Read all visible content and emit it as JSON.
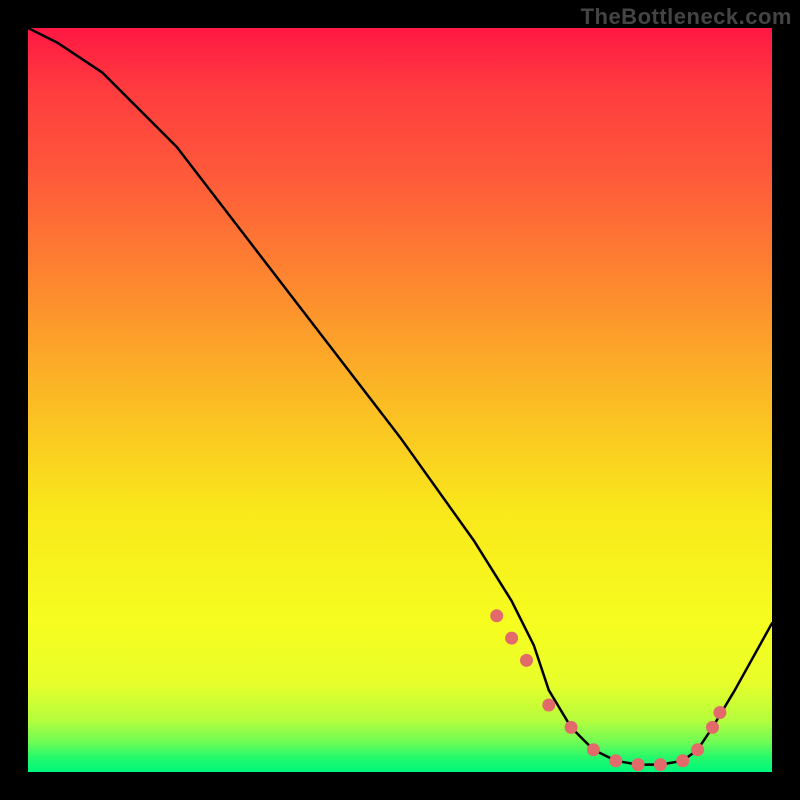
{
  "watermark": "TheBottleneck.com",
  "chart_data": {
    "type": "line",
    "title": "",
    "xlabel": "",
    "ylabel": "",
    "xlim": [
      0,
      100
    ],
    "ylim": [
      0,
      100
    ],
    "series": [
      {
        "name": "curve",
        "x": [
          0,
          4,
          10,
          20,
          30,
          40,
          50,
          60,
          65,
          68,
          70,
          73,
          76,
          79,
          82,
          85,
          88,
          90,
          92,
          95,
          100
        ],
        "values": [
          100,
          98,
          94,
          84,
          71,
          58,
          45,
          31,
          23,
          17,
          11,
          6,
          3,
          1.5,
          1,
          1,
          1.5,
          3,
          6,
          11,
          20
        ]
      }
    ],
    "markers": {
      "name": "dots",
      "x": [
        63,
        65,
        67,
        70,
        73,
        76,
        79,
        82,
        85,
        88,
        90,
        92,
        93
      ],
      "values": [
        21,
        18,
        15,
        9,
        6,
        3,
        1.5,
        1,
        1,
        1.5,
        3,
        6,
        8
      ]
    },
    "colors": {
      "curve": "#000000",
      "marker_fill": "#e26a6a",
      "marker_stroke": "#e26a6a"
    }
  }
}
